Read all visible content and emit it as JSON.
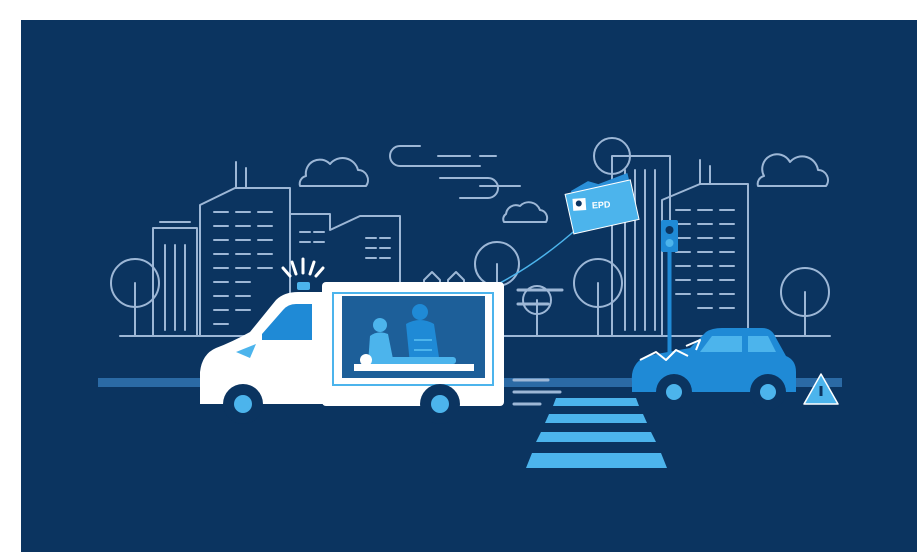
{
  "scene": {
    "folder": {
      "label": "EPD"
    },
    "colors": {
      "background": "#0b3460",
      "page": "#ffffff",
      "line": "#9db7d6",
      "accent": "#1f8ad6",
      "light_accent": "#4cb4ec",
      "white": "#ffffff"
    },
    "icons": [
      "ambulance-icon",
      "paramedic-icon",
      "patient-icon",
      "car-icon",
      "warning-triangle-icon",
      "traffic-light-icon",
      "folder-icon",
      "cloud-icon",
      "tree-icon",
      "building-icon",
      "crosswalk-icon"
    ]
  }
}
